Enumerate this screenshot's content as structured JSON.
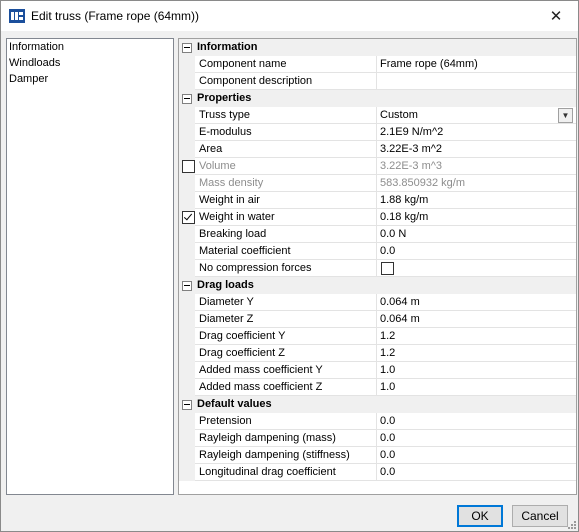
{
  "window": {
    "title": "Edit truss (Frame rope (64mm))"
  },
  "sidebar": {
    "items": [
      "Information",
      "Windloads",
      "Damper"
    ]
  },
  "grid": {
    "categories": [
      {
        "label": "Information",
        "rows": [
          {
            "name": "Component name",
            "value": "Frame rope (64mm)"
          },
          {
            "name": "Component description",
            "value": ""
          }
        ]
      },
      {
        "label": "Properties",
        "rows": [
          {
            "name": "Truss type",
            "value": "Custom",
            "dropdown": true
          },
          {
            "name": "E-modulus",
            "value": "2.1E9 N/m^2"
          },
          {
            "name": "Area",
            "value": "3.22E-3 m^2"
          },
          {
            "name": "Volume",
            "value": "3.22E-3 m^3",
            "disabled": true,
            "checkbox": false
          },
          {
            "name": "Mass density",
            "value": "583.850932 kg/m",
            "disabled": true
          },
          {
            "name": "Weight in air",
            "value": "1.88 kg/m"
          },
          {
            "name": "Weight in water",
            "value": "0.18 kg/m",
            "checkbox": true
          },
          {
            "name": "Breaking load",
            "value": "0.0 N"
          },
          {
            "name": "Material coefficient",
            "value": "0.0"
          },
          {
            "name": "No compression forces",
            "value": "",
            "value_checkbox": false
          }
        ]
      },
      {
        "label": "Drag loads",
        "rows": [
          {
            "name": "Diameter Y",
            "value": "0.064 m"
          },
          {
            "name": "Diameter Z",
            "value": "0.064 m"
          },
          {
            "name": "Drag coefficient Y",
            "value": "1.2"
          },
          {
            "name": "Drag coefficient Z",
            "value": "1.2"
          },
          {
            "name": "Added mass coefficient Y",
            "value": "1.0"
          },
          {
            "name": "Added mass coefficient Z",
            "value": "1.0"
          }
        ]
      },
      {
        "label": "Default values",
        "rows": [
          {
            "name": "Pretension",
            "value": "0.0"
          },
          {
            "name": "Rayleigh dampening (mass)",
            "value": "0.0"
          },
          {
            "name": "Rayleigh dampening (stiffness)",
            "value": "0.0"
          },
          {
            "name": "Longitudinal drag coefficient",
            "value": "0.0"
          }
        ]
      }
    ]
  },
  "buttons": {
    "ok": "OK",
    "cancel": "Cancel"
  },
  "icons": {
    "close": "close-icon",
    "app": "app-icon",
    "dropdown": "chevron-down-icon"
  },
  "colors": {
    "accent": "#0078d7",
    "disabled_text": "#8d8d8d"
  }
}
